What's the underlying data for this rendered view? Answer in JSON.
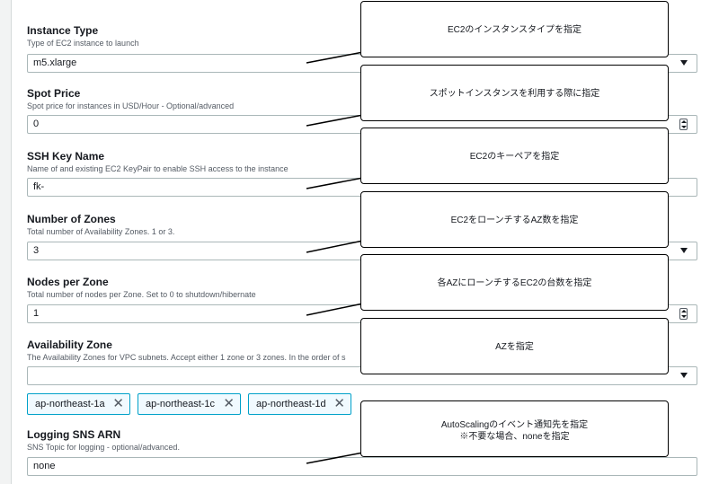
{
  "fields": [
    {
      "label": "Instance Type",
      "desc": "Type of EC2 instance to launch",
      "value": "m5.xlarge",
      "control": "select"
    },
    {
      "label": "Spot Price",
      "desc": "Spot price for instances in USD/Hour - Optional/advanced",
      "value": "0",
      "control": "number"
    },
    {
      "label": "SSH Key Name",
      "desc": "Name of and existing EC2 KeyPair to enable SSH access to the instance",
      "value": "fk-",
      "control": "text"
    },
    {
      "label": "Number of Zones",
      "desc": "Total number of Availability Zones. 1 or 3.",
      "value": "3",
      "control": "select"
    },
    {
      "label": "Nodes per Zone",
      "desc": "Total number of nodes per Zone. Set to 0 to shutdown/hibernate",
      "value": "1",
      "control": "number"
    },
    {
      "label": "Availability Zone",
      "desc": "The Availability Zones for VPC subnets. Accept either 1 zone or 3 zones. In the order of s",
      "value": "",
      "control": "select"
    },
    {
      "label": "Logging SNS ARN",
      "desc": "SNS Topic for logging - optional/advanced.",
      "value": "none",
      "control": "text"
    }
  ],
  "zone_tokens": [
    "ap-northeast-1a",
    "ap-northeast-1c",
    "ap-northeast-1d"
  ],
  "token_remove_glyph": "✕",
  "callouts": [
    {
      "line1": "EC2のインスタンスタイプを指定",
      "line2": ""
    },
    {
      "line1": "スポットインスタンスを利用する際に指定",
      "line2": ""
    },
    {
      "line1": "EC2のキーペアを指定",
      "line2": ""
    },
    {
      "line1": "EC2をローンチするAZ数を指定",
      "line2": ""
    },
    {
      "line1": "各AZにローンチするEC2の台数を指定",
      "line2": ""
    },
    {
      "line1": "AZを指定",
      "line2": ""
    },
    {
      "line1": "AutoScalingのイベント通知先を指定",
      "line2": "※不要な場合、noneを指定"
    }
  ],
  "colors": {
    "token_border": "#00a1c9",
    "token_bg": "#f1faff",
    "input_border": "#aab7b8"
  }
}
